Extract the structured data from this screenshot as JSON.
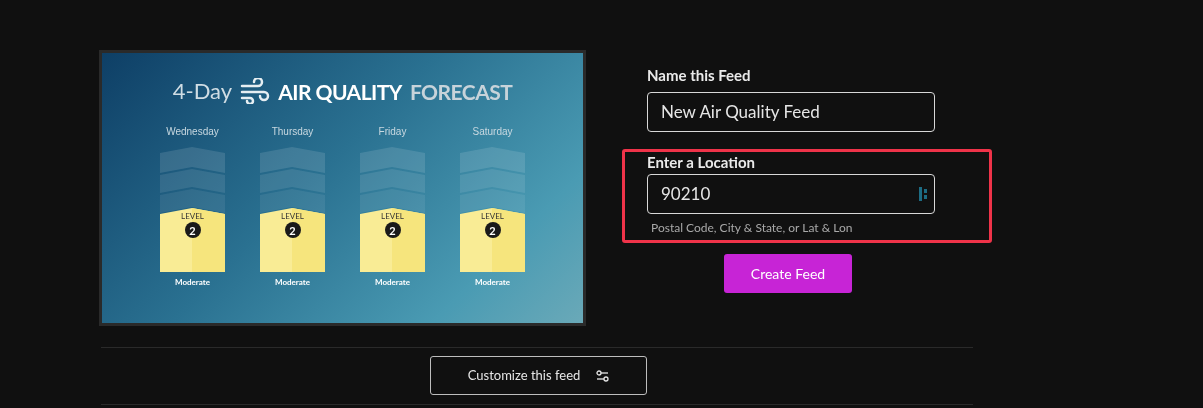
{
  "preview": {
    "title_prefix": "4-Day",
    "title_main": "AIR QUALITY",
    "title_suffix": "FORECAST",
    "days": [
      {
        "day": "Wednesday",
        "level_label": "LEVEL",
        "level_number": "2",
        "category": "Moderate"
      },
      {
        "day": "Thursday",
        "level_label": "LEVEL",
        "level_number": "2",
        "category": "Moderate"
      },
      {
        "day": "Friday",
        "level_label": "LEVEL",
        "level_number": "2",
        "category": "Moderate"
      },
      {
        "day": "Saturday",
        "level_label": "LEVEL",
        "level_number": "2",
        "category": "Moderate"
      }
    ]
  },
  "form": {
    "name_label": "Name this Feed",
    "name_value": "New Air Quality Feed",
    "location_label": "Enter a Location",
    "location_value": "90210",
    "location_hint": "Postal Code, City & State, or Lat & Lon",
    "location_highlighted": true,
    "submit": "Create Feed"
  },
  "customize_button": "Customize this feed"
}
